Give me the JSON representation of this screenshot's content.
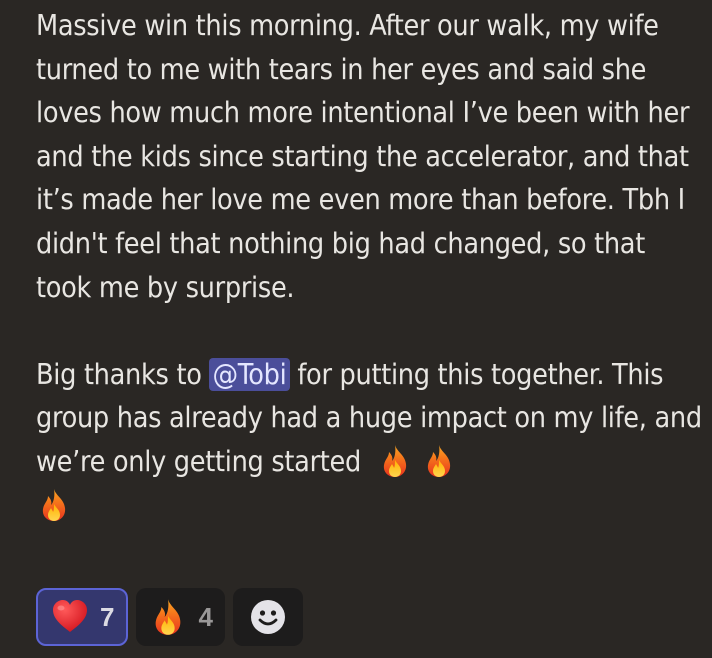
{
  "message": {
    "paragraph1": "Massive win this morning. After our walk, my wife turned to me with tears in her eyes and said she loves how much more intentional I’ve been with her and the kids since starting the accelerator, and that it’s made her love me even more than before. Tbh I didn't feel that nothing big had changed, so that took me by surprise.",
    "p2_before": "Big thanks to ",
    "mention": "@Tobi",
    "p2_after": " for putting this together. This group has already had a huge impact on my life, and we’re only getting started ",
    "trailing_emojis": [
      "fire-icon",
      "fire-icon",
      "fire-icon"
    ]
  },
  "reactions": [
    {
      "emoji": "heart-icon",
      "count": "7",
      "active": true
    },
    {
      "emoji": "fire-icon",
      "count": "4",
      "active": false
    }
  ],
  "add_reaction": {
    "icon": "smiley-face-icon"
  },
  "colors": {
    "background": "#2a2724",
    "text": "#e8e6e2",
    "mention_bg": "#4b4e9a",
    "reaction_active_bg": "#34376e",
    "reaction_active_border": "#5c64d6",
    "reaction_bg": "#1d1c1c"
  }
}
